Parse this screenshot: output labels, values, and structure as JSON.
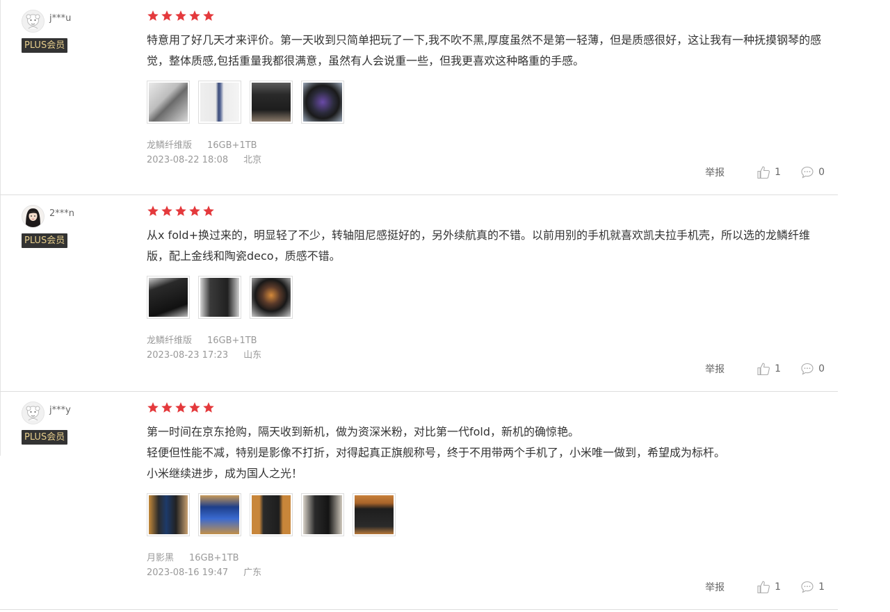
{
  "plus_label": "PLUS会员",
  "report_label": "举报",
  "colors": {
    "star": "#e4393c",
    "badge_bg": "#333333",
    "badge_text": "#e8cf8c"
  },
  "reviews": [
    {
      "user": "j***u",
      "avatar_icon": "sheep-avatar-icon",
      "rating": 5,
      "text": [
        "特意用了好几天才来评价。第一天收到只简单把玩了一下,我不吹不黑,厚度虽然不是第一轻薄，但是质感很好，这让我有一种抚摸钢琴的感觉，整体质感,包括重量我都很满意，虽然有人会说重一些，但我更喜欢这种略重的手感。"
      ],
      "photo_count": 4,
      "variant": "龙鳞纤维版",
      "spec": "16GB+1TB",
      "date": "2023-08-22 18:08",
      "location": "北京",
      "likes": "1",
      "comments": "0"
    },
    {
      "user": "2***n",
      "avatar_icon": "girl-avatar-icon",
      "rating": 5,
      "text": [
        "从x fold+换过来的，明显轻了不少，转轴阻尼感挺好的，另外续航真的不错。以前用别的手机就喜欢凯夫拉手机壳，所以选的龙鳞纤维版，配上金线和陶瓷deco，质感不错。"
      ],
      "photo_count": 3,
      "variant": "龙鳞纤维版",
      "spec": "16GB+1TB",
      "date": "2023-08-23 17:23",
      "location": "山东",
      "likes": "1",
      "comments": "0"
    },
    {
      "user": "j***y",
      "avatar_icon": "sheep-avatar-icon",
      "rating": 5,
      "text": [
        "第一时间在京东抢购，隔天收到新机，做为资深米粉，对比第一代fold，新机的确惊艳。",
        "轻便但性能不减，特别是影像不打折，对得起真正旗舰称号，终于不用带两个手机了，小米唯一做到，希望成为标杆。",
        "小米继续进步，成为国人之光！"
      ],
      "photo_count": 5,
      "variant": "月影黑",
      "spec": "16GB+1TB",
      "date": "2023-08-16 19:47",
      "location": "广东",
      "likes": "1",
      "comments": "1"
    }
  ]
}
